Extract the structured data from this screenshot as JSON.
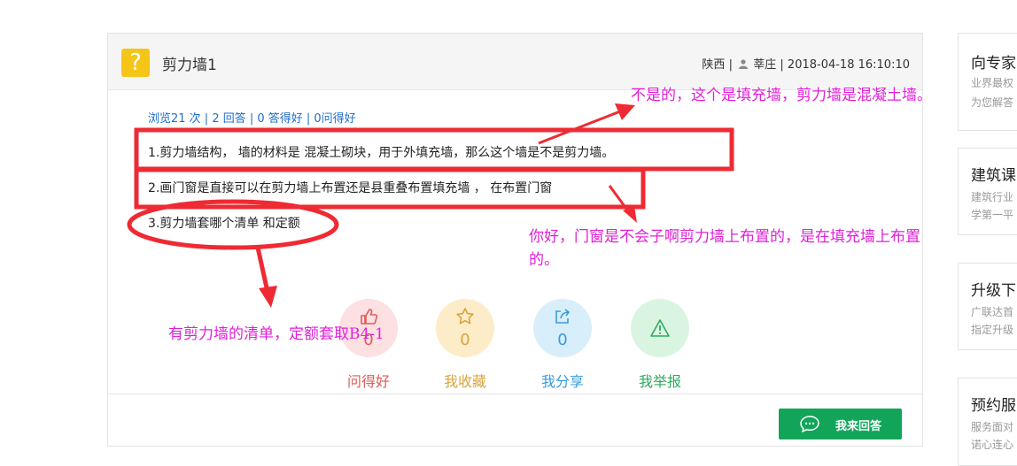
{
  "question": {
    "title": "剪力墙1",
    "province": "陕西",
    "separator": "|",
    "user": "莘庄",
    "datetime": "2018-04-18 16:10:10",
    "stats": "浏览21 次 | 2 回答 | 0 答得好 | 0问得好",
    "lines": [
      "1.剪力墙结构， 墙的材料是 混凝土砌块，用于外填充墙，那么这个墙是不是剪力墙。",
      "2.画门窗是直接可以在剪力墙上布置还是县重叠布置填充墙 ， 在布置门窗",
      "3.剪力墙套哪个清单 和定额"
    ]
  },
  "actions": [
    {
      "label": "问得好",
      "count": "0",
      "color": "#e05a5a",
      "bg": "#fde0e2",
      "icon": "thumbs-up-icon"
    },
    {
      "label": "我收藏",
      "count": "0",
      "color": "#d9a43e",
      "bg": "#fdecc8",
      "icon": "star-icon"
    },
    {
      "label": "我分享",
      "count": "0",
      "color": "#3a9bd8",
      "bg": "#d8eefb",
      "icon": "share-icon"
    },
    {
      "label": "我举报",
      "count": "",
      "color": "#2fa860",
      "bg": "#d9f5e1",
      "icon": "warning-icon"
    }
  ],
  "answer_button": {
    "label": "我来回答",
    "color": "#12a55a"
  },
  "sidebar": [
    {
      "title": "向专家",
      "desc": [
        "业界最权",
        "为您解答"
      ]
    },
    {
      "title": "建筑课",
      "desc": [
        "建筑行业",
        "学第一平"
      ]
    },
    {
      "title": "升级下",
      "desc": [
        "广联达首",
        "指定升级"
      ]
    },
    {
      "title": "预约服",
      "desc": [
        "服务面对",
        "诺心连心"
      ]
    }
  ],
  "annotations": {
    "a1": "不是的，这个是填充墙，剪力墙是混凝土墙。",
    "a2_line1": "你好，门窗是不会子啊剪力墙上布置的，是在填充墙上布置",
    "a2_line2": "的。",
    "a3": "有剪力墙的清单，定额套取B4-1",
    "color": "#e020d8",
    "markup_color": "#ee2a33"
  }
}
